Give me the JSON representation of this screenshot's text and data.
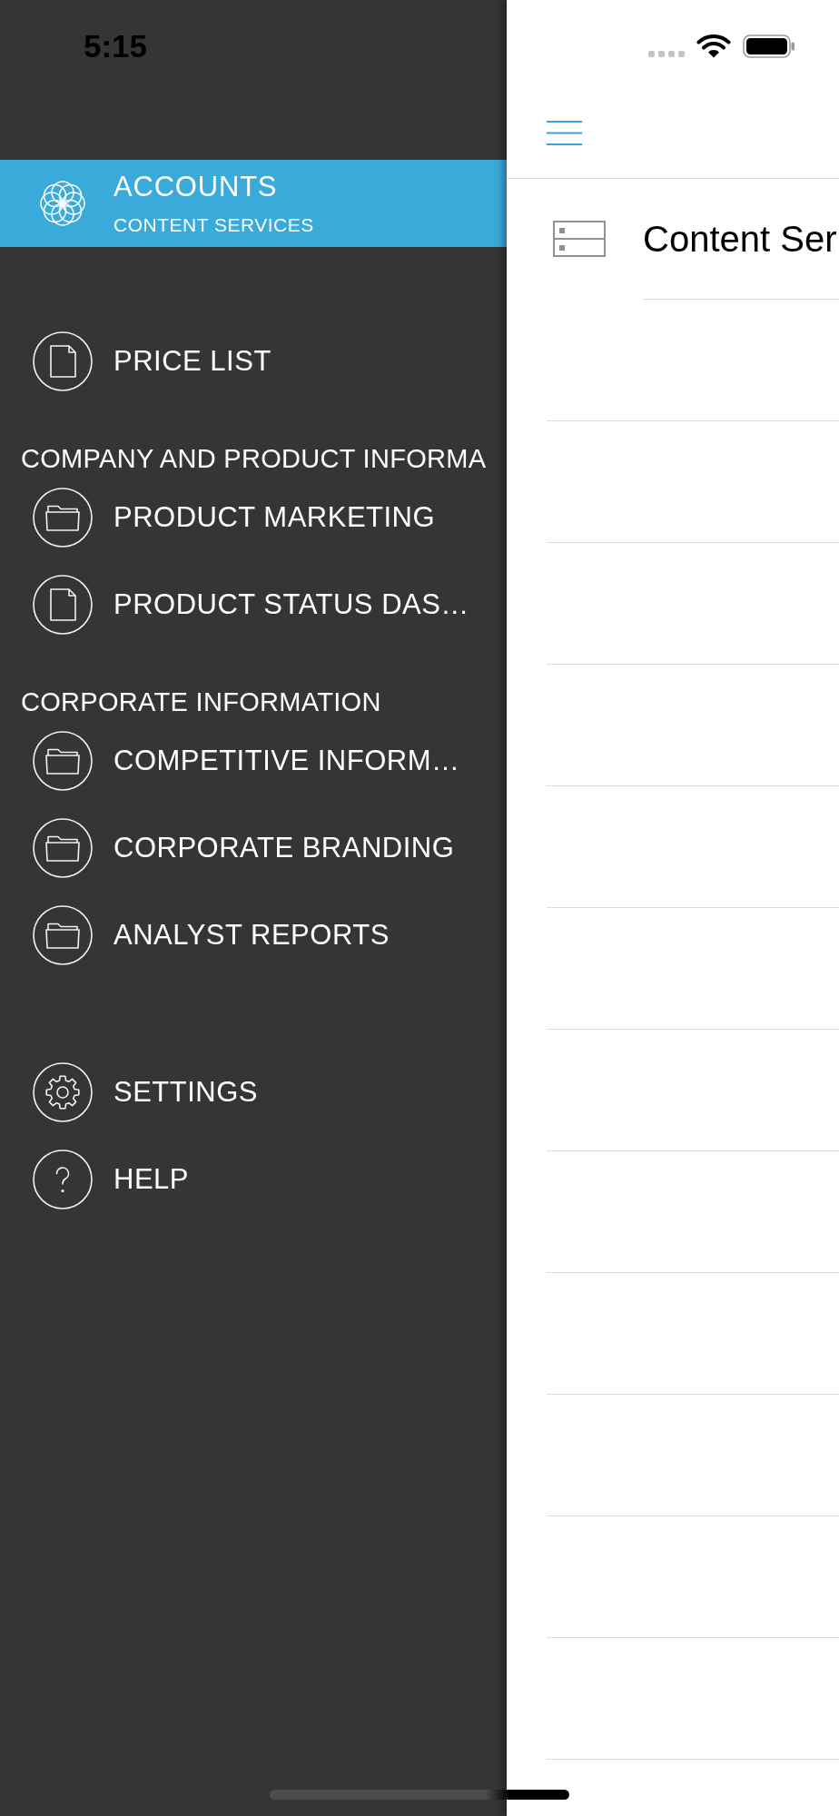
{
  "status_bar": {
    "time": "5:15"
  },
  "sidebar": {
    "account": {
      "title": "ACCOUNTS",
      "subtitle": "CONTENT SERVICES",
      "selected": true
    },
    "sections": [
      {
        "items": [
          {
            "label": "PRICE LIST",
            "kind": "document",
            "selected": false
          }
        ]
      },
      {
        "title": "COMPANY AND PRODUCT INFORMA",
        "items": [
          {
            "label": "PRODUCT MARKETING",
            "kind": "folder",
            "selected": false
          },
          {
            "label": "PRODUCT STATUS DAS…",
            "kind": "document",
            "selected": false
          }
        ]
      },
      {
        "title": "CORPORATE INFORMATION",
        "items": [
          {
            "label": "COMPETITIVE INFORM…",
            "kind": "folder",
            "selected": false
          },
          {
            "label": "CORPORATE BRANDING",
            "kind": "folder",
            "selected": false
          },
          {
            "label": "ANALYST REPORTS",
            "kind": "folder",
            "selected": false
          }
        ]
      }
    ],
    "footer_items": [
      {
        "label": "SETTINGS",
        "kind": "settings",
        "selected": false
      },
      {
        "label": "HELP",
        "kind": "help",
        "selected": false
      }
    ]
  },
  "main": {
    "rows": [
      {
        "title": "Content Ser"
      }
    ]
  }
}
